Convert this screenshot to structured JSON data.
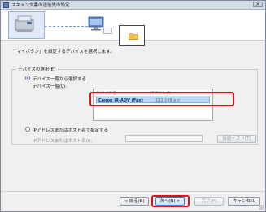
{
  "window": {
    "title": "スキャン文書の送信先の設定",
    "close_glyph": "✕"
  },
  "instruction": "「マイボタン」を設定するデバイスを選択します。",
  "device_group": {
    "label": "デバイスの選択(E)",
    "option_list": "デバイス一覧から選択する",
    "list_label": "デバイス一覧(L):",
    "list_headers": [
      "デバイス名",
      "IPアドレス"
    ],
    "rows": [
      {
        "name": "Canon iR-ADV (Fax)",
        "address": "192.168.x.x"
      }
    ],
    "option_ip": "IPアドレスまたはホスト名で指定する",
    "ip_label": "IPアドレスまたはホスト名(I):",
    "ip_value": "",
    "test_button": "接続テスト(T)"
  },
  "footer": {
    "back": "< 戻る(B)",
    "next": "次へ(N) >",
    "finish": "完了(F)",
    "cancel": "キャンセル"
  },
  "colors": {
    "highlight": "#e0101a",
    "selection": "#b9d7f6"
  }
}
